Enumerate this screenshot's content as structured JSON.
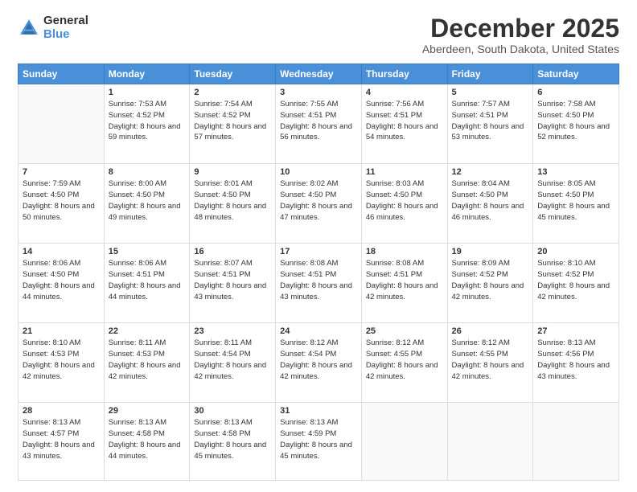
{
  "logo": {
    "general": "General",
    "blue": "Blue"
  },
  "title": {
    "month": "December 2025",
    "location": "Aberdeen, South Dakota, United States"
  },
  "weekdays": [
    "Sunday",
    "Monday",
    "Tuesday",
    "Wednesday",
    "Thursday",
    "Friday",
    "Saturday"
  ],
  "weeks": [
    [
      {
        "day": "",
        "sunrise": "",
        "sunset": "",
        "daylight": ""
      },
      {
        "day": "1",
        "sunrise": "Sunrise: 7:53 AM",
        "sunset": "Sunset: 4:52 PM",
        "daylight": "Daylight: 8 hours and 59 minutes."
      },
      {
        "day": "2",
        "sunrise": "Sunrise: 7:54 AM",
        "sunset": "Sunset: 4:52 PM",
        "daylight": "Daylight: 8 hours and 57 minutes."
      },
      {
        "day": "3",
        "sunrise": "Sunrise: 7:55 AM",
        "sunset": "Sunset: 4:51 PM",
        "daylight": "Daylight: 8 hours and 56 minutes."
      },
      {
        "day": "4",
        "sunrise": "Sunrise: 7:56 AM",
        "sunset": "Sunset: 4:51 PM",
        "daylight": "Daylight: 8 hours and 54 minutes."
      },
      {
        "day": "5",
        "sunrise": "Sunrise: 7:57 AM",
        "sunset": "Sunset: 4:51 PM",
        "daylight": "Daylight: 8 hours and 53 minutes."
      },
      {
        "day": "6",
        "sunrise": "Sunrise: 7:58 AM",
        "sunset": "Sunset: 4:50 PM",
        "daylight": "Daylight: 8 hours and 52 minutes."
      }
    ],
    [
      {
        "day": "7",
        "sunrise": "Sunrise: 7:59 AM",
        "sunset": "Sunset: 4:50 PM",
        "daylight": "Daylight: 8 hours and 50 minutes."
      },
      {
        "day": "8",
        "sunrise": "Sunrise: 8:00 AM",
        "sunset": "Sunset: 4:50 PM",
        "daylight": "Daylight: 8 hours and 49 minutes."
      },
      {
        "day": "9",
        "sunrise": "Sunrise: 8:01 AM",
        "sunset": "Sunset: 4:50 PM",
        "daylight": "Daylight: 8 hours and 48 minutes."
      },
      {
        "day": "10",
        "sunrise": "Sunrise: 8:02 AM",
        "sunset": "Sunset: 4:50 PM",
        "daylight": "Daylight: 8 hours and 47 minutes."
      },
      {
        "day": "11",
        "sunrise": "Sunrise: 8:03 AM",
        "sunset": "Sunset: 4:50 PM",
        "daylight": "Daylight: 8 hours and 46 minutes."
      },
      {
        "day": "12",
        "sunrise": "Sunrise: 8:04 AM",
        "sunset": "Sunset: 4:50 PM",
        "daylight": "Daylight: 8 hours and 46 minutes."
      },
      {
        "day": "13",
        "sunrise": "Sunrise: 8:05 AM",
        "sunset": "Sunset: 4:50 PM",
        "daylight": "Daylight: 8 hours and 45 minutes."
      }
    ],
    [
      {
        "day": "14",
        "sunrise": "Sunrise: 8:06 AM",
        "sunset": "Sunset: 4:50 PM",
        "daylight": "Daylight: 8 hours and 44 minutes."
      },
      {
        "day": "15",
        "sunrise": "Sunrise: 8:06 AM",
        "sunset": "Sunset: 4:51 PM",
        "daylight": "Daylight: 8 hours and 44 minutes."
      },
      {
        "day": "16",
        "sunrise": "Sunrise: 8:07 AM",
        "sunset": "Sunset: 4:51 PM",
        "daylight": "Daylight: 8 hours and 43 minutes."
      },
      {
        "day": "17",
        "sunrise": "Sunrise: 8:08 AM",
        "sunset": "Sunset: 4:51 PM",
        "daylight": "Daylight: 8 hours and 43 minutes."
      },
      {
        "day": "18",
        "sunrise": "Sunrise: 8:08 AM",
        "sunset": "Sunset: 4:51 PM",
        "daylight": "Daylight: 8 hours and 42 minutes."
      },
      {
        "day": "19",
        "sunrise": "Sunrise: 8:09 AM",
        "sunset": "Sunset: 4:52 PM",
        "daylight": "Daylight: 8 hours and 42 minutes."
      },
      {
        "day": "20",
        "sunrise": "Sunrise: 8:10 AM",
        "sunset": "Sunset: 4:52 PM",
        "daylight": "Daylight: 8 hours and 42 minutes."
      }
    ],
    [
      {
        "day": "21",
        "sunrise": "Sunrise: 8:10 AM",
        "sunset": "Sunset: 4:53 PM",
        "daylight": "Daylight: 8 hours and 42 minutes."
      },
      {
        "day": "22",
        "sunrise": "Sunrise: 8:11 AM",
        "sunset": "Sunset: 4:53 PM",
        "daylight": "Daylight: 8 hours and 42 minutes."
      },
      {
        "day": "23",
        "sunrise": "Sunrise: 8:11 AM",
        "sunset": "Sunset: 4:54 PM",
        "daylight": "Daylight: 8 hours and 42 minutes."
      },
      {
        "day": "24",
        "sunrise": "Sunrise: 8:12 AM",
        "sunset": "Sunset: 4:54 PM",
        "daylight": "Daylight: 8 hours and 42 minutes."
      },
      {
        "day": "25",
        "sunrise": "Sunrise: 8:12 AM",
        "sunset": "Sunset: 4:55 PM",
        "daylight": "Daylight: 8 hours and 42 minutes."
      },
      {
        "day": "26",
        "sunrise": "Sunrise: 8:12 AM",
        "sunset": "Sunset: 4:55 PM",
        "daylight": "Daylight: 8 hours and 42 minutes."
      },
      {
        "day": "27",
        "sunrise": "Sunrise: 8:13 AM",
        "sunset": "Sunset: 4:56 PM",
        "daylight": "Daylight: 8 hours and 43 minutes."
      }
    ],
    [
      {
        "day": "28",
        "sunrise": "Sunrise: 8:13 AM",
        "sunset": "Sunset: 4:57 PM",
        "daylight": "Daylight: 8 hours and 43 minutes."
      },
      {
        "day": "29",
        "sunrise": "Sunrise: 8:13 AM",
        "sunset": "Sunset: 4:58 PM",
        "daylight": "Daylight: 8 hours and 44 minutes."
      },
      {
        "day": "30",
        "sunrise": "Sunrise: 8:13 AM",
        "sunset": "Sunset: 4:58 PM",
        "daylight": "Daylight: 8 hours and 45 minutes."
      },
      {
        "day": "31",
        "sunrise": "Sunrise: 8:13 AM",
        "sunset": "Sunset: 4:59 PM",
        "daylight": "Daylight: 8 hours and 45 minutes."
      },
      {
        "day": "",
        "sunrise": "",
        "sunset": "",
        "daylight": ""
      },
      {
        "day": "",
        "sunrise": "",
        "sunset": "",
        "daylight": ""
      },
      {
        "day": "",
        "sunrise": "",
        "sunset": "",
        "daylight": ""
      }
    ]
  ]
}
